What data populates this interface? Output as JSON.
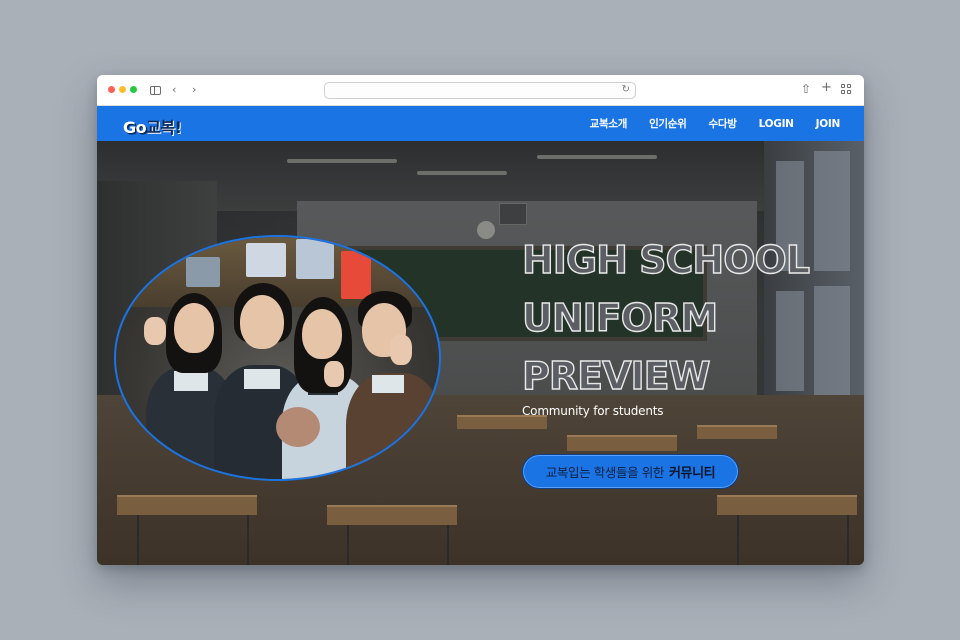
{
  "browser": {
    "address_value": "",
    "icons": [
      "sidebar-icon",
      "back-icon",
      "forward-icon",
      "reload-icon",
      "share-icon",
      "new-tab-icon",
      "tab-overview-icon"
    ]
  },
  "site": {
    "logo_go": "Go",
    "logo_text": "교복!",
    "brand_color": "#1a74e4",
    "nav": [
      {
        "label": "교복소개"
      },
      {
        "label": "인기순위"
      },
      {
        "label": "수다방"
      },
      {
        "label": "LOGIN"
      },
      {
        "label": "JOIN"
      }
    ]
  },
  "hero": {
    "title": "HIGH SCHOOL\nUNIFORM\nPREVIEW",
    "subtitle": "Community for students",
    "cta_prefix": "교복입는 학생들을 위한",
    "cta_emphasis": "커뮤니티"
  }
}
